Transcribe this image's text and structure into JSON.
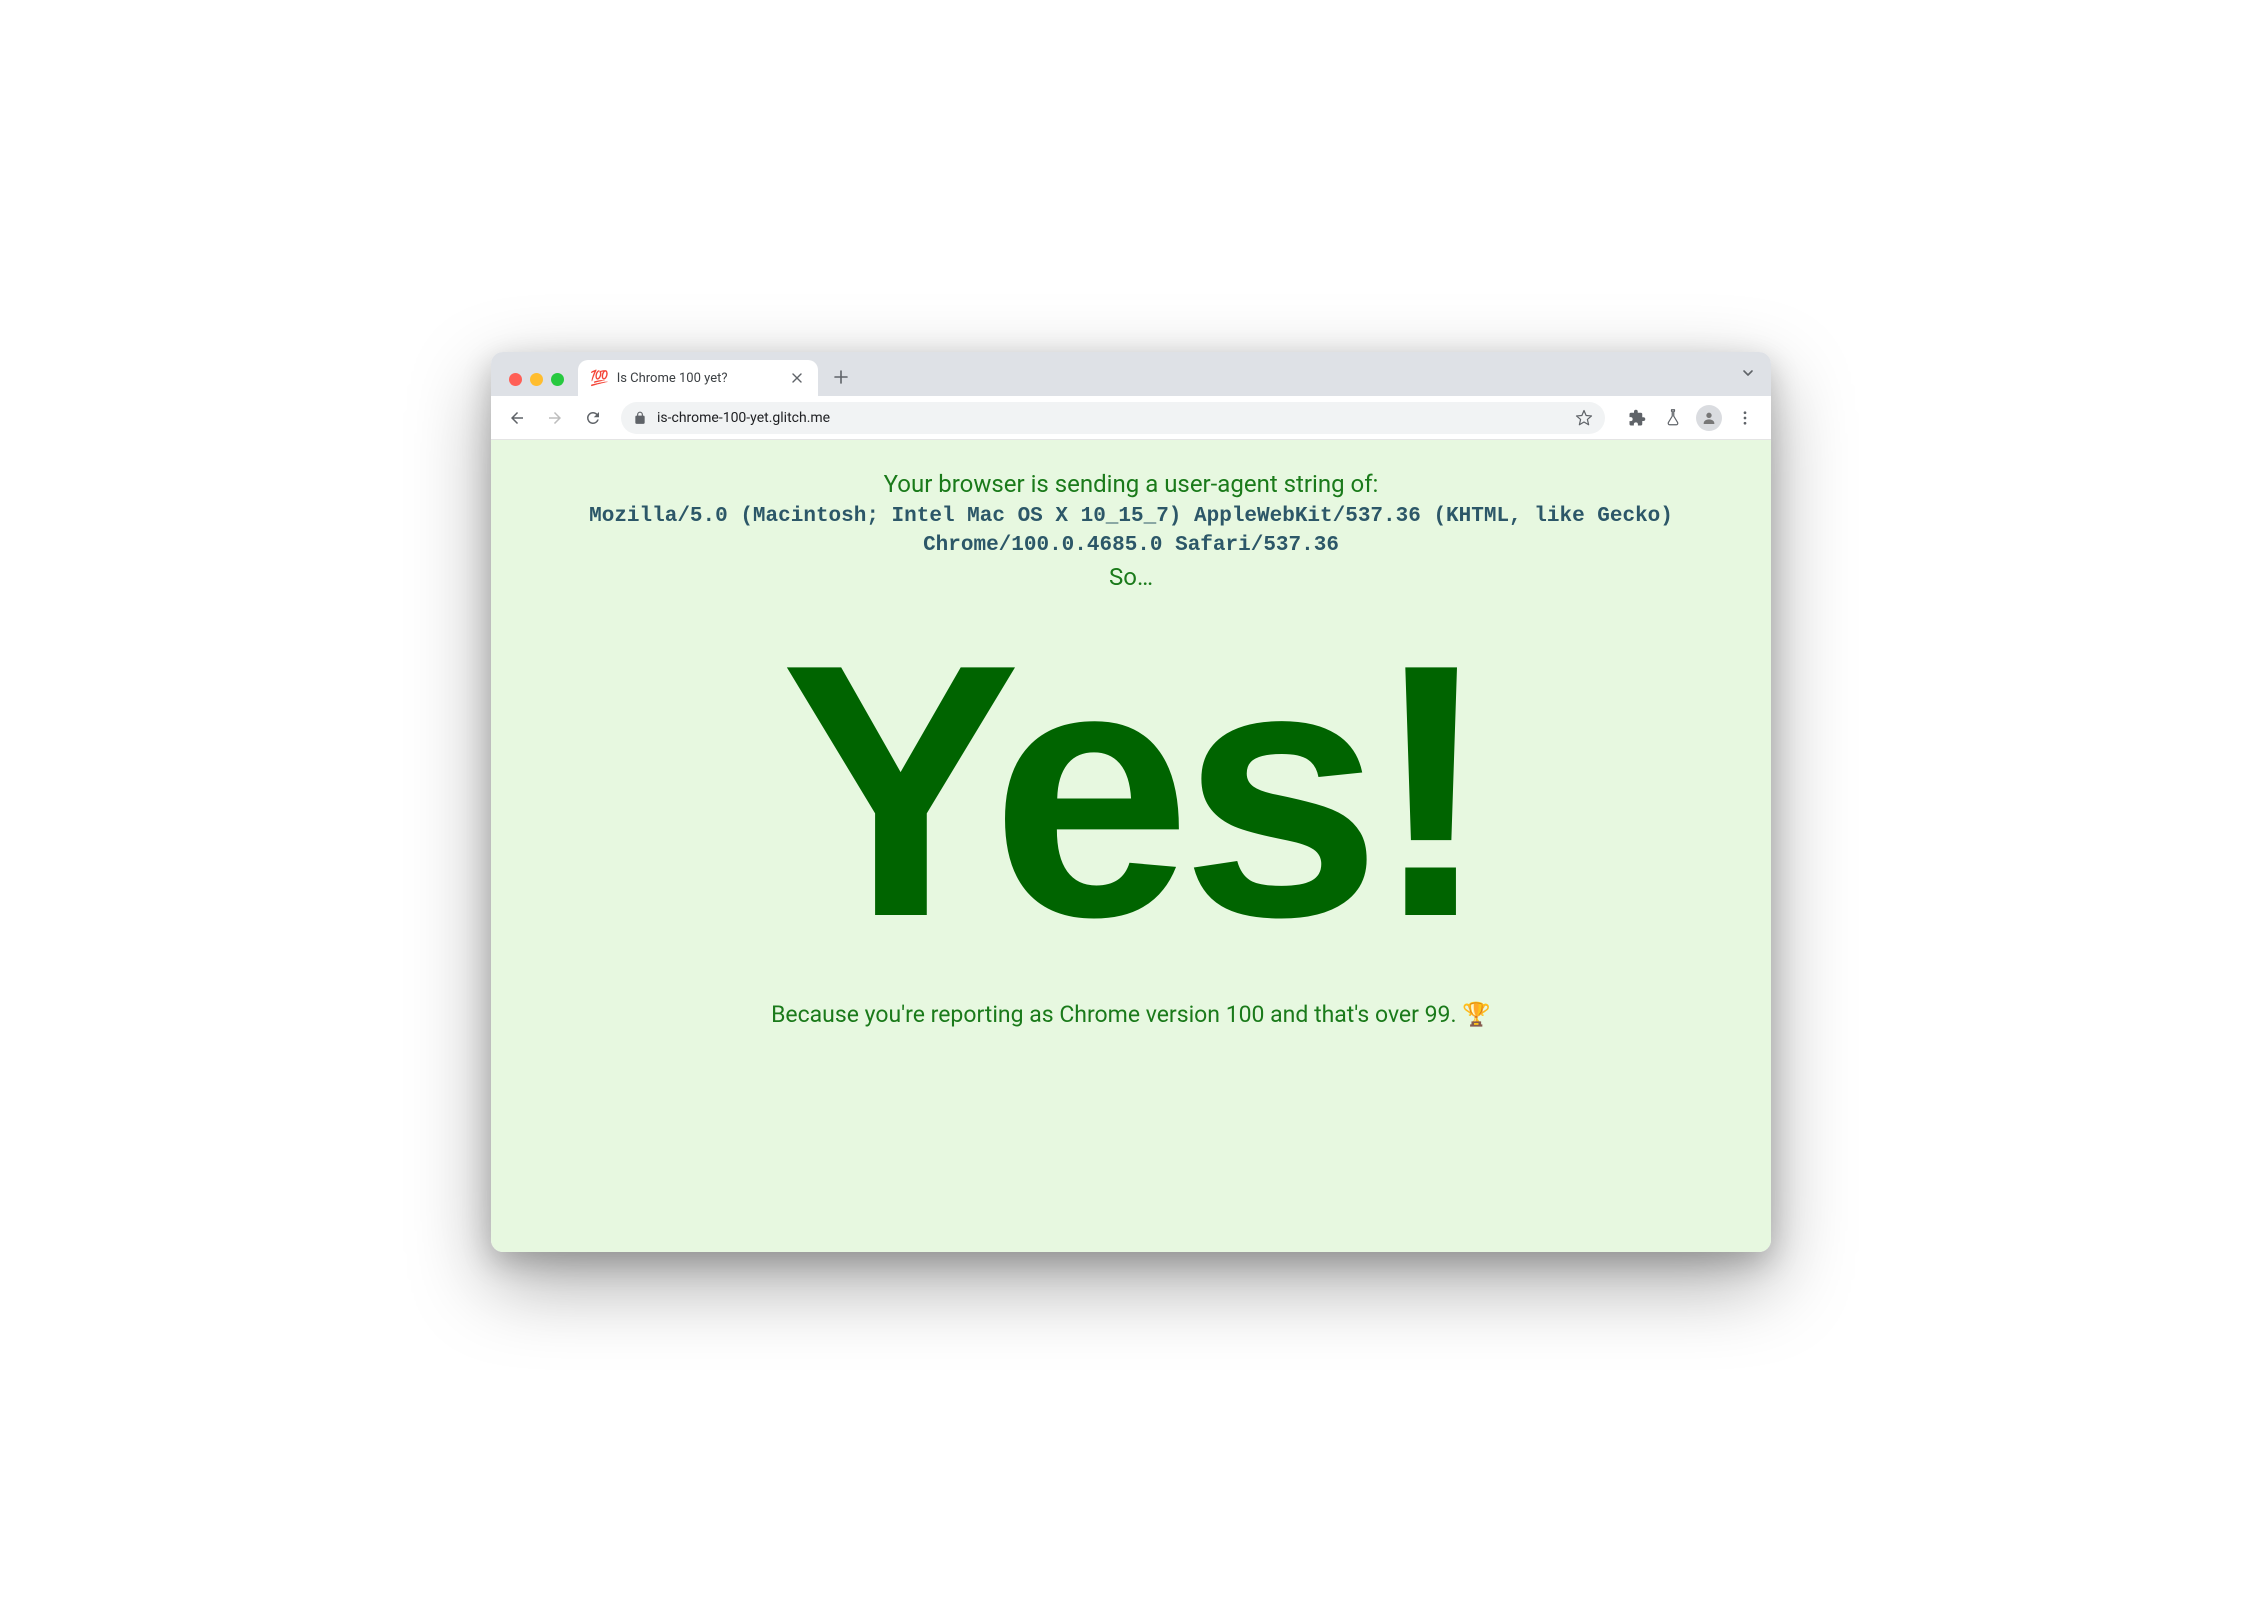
{
  "tab": {
    "favicon": "💯",
    "title": "Is Chrome 100 yet?"
  },
  "toolbar": {
    "url": "is-chrome-100-yet.glitch.me"
  },
  "page": {
    "ua_intro": "Your browser is sending a user-agent string of:",
    "ua_string": "Mozilla/5.0 (Macintosh; Intel Mac OS X 10_15_7) AppleWebKit/537.36 (KHTML, like Gecko) Chrome/100.0.4685.0 Safari/537.36",
    "so": "So…",
    "answer": "Yes!",
    "because": "Because you're reporting as Chrome version 100 and that's over 99. 🏆"
  }
}
